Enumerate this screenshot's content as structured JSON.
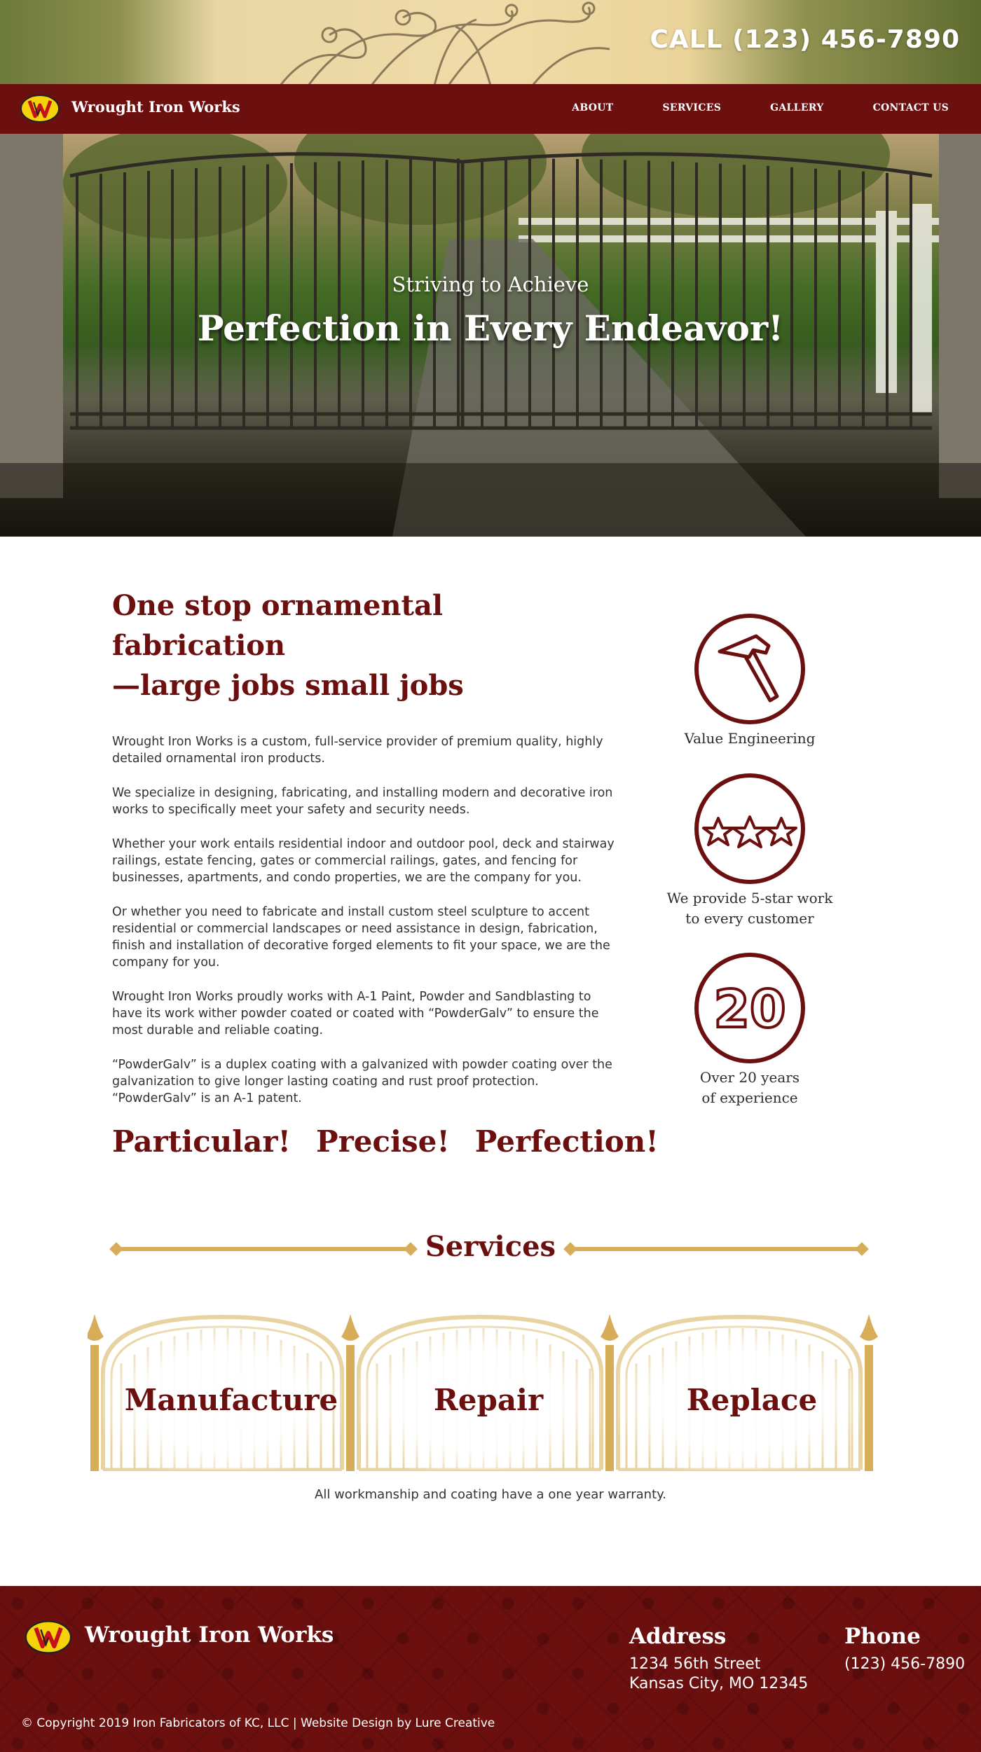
{
  "header": {
    "phone_cta": "CALL (123) 456-7890",
    "brand": "Wrought Iron Works",
    "nav": [
      "ABOUT",
      "SERVICES",
      "GALLERY",
      "CONTACT US"
    ]
  },
  "hero": {
    "subtitle": "Striving to Achieve",
    "title": "Perfection in Every Endeavor!"
  },
  "about": {
    "heading_line1": "One stop ornamental fabrication",
    "heading_line2": "—large jobs small jobs",
    "paragraphs": [
      "Wrought Iron Works is a custom, full-service provider of premium quality, highly detailed ornamental iron products.",
      "We specialize in designing, fabricating, and installing modern and decorative iron works to specifically meet your safety and security needs.",
      "Whether your work entails residential indoor and outdoor pool, deck and stairway railings, estate fencing, gates or commercial railings, gates, and fencing for businesses, apartments, and condo properties, we are the company for you.",
      "Or whether you need to fabricate and install custom steel sculpture to accent residential or commercial landscapes or need assistance in design, fabrication, finish and installation of decorative forged elements to fit your space, we are the company for you.",
      "Wrought Iron Works proudly works with A-1 Paint, Powder and Sandblasting to have its work wither powder coated or coated with “PowderGalv” to ensure the most durable and reliable coating.",
      "“PowderGalv” is a duplex coating with a galvanized with powder coating over the galvanization to give longer lasting coating and rust proof protection. “PowderGalv” is an A-1 patent."
    ],
    "taglines": [
      "Particular!",
      "Precise!",
      "Perfection!"
    ]
  },
  "features": [
    {
      "icon": "hammer-icon",
      "label_line1": "Value Engineering",
      "label_line2": ""
    },
    {
      "icon": "stars-icon",
      "label_line1": "We provide 5-star work",
      "label_line2": "to every customer"
    },
    {
      "icon": "twenty-icon",
      "number": "20",
      "label_line1": "Over 20 years",
      "label_line2": "of experience"
    }
  ],
  "services": {
    "title": "Services",
    "items": [
      "Manufacture",
      "Repair",
      "Replace"
    ],
    "warranty": "All workmanship and coating have a one year warranty."
  },
  "footer": {
    "brand": "Wrought Iron Works",
    "address_heading": "Address",
    "address_line1": "1234 56th Street",
    "address_line2": "Kansas City, MO 12345",
    "phone_heading": "Phone",
    "phone": "(123) 456-7890",
    "copyright": "© Copyright 2019 Iron Fabricators of KC, LLC | Website Design by Lure Creative"
  },
  "colors": {
    "brand_maroon": "#6b0f0f",
    "gold": "#d8ad5a",
    "logo_yellow": "#f5d20a"
  }
}
